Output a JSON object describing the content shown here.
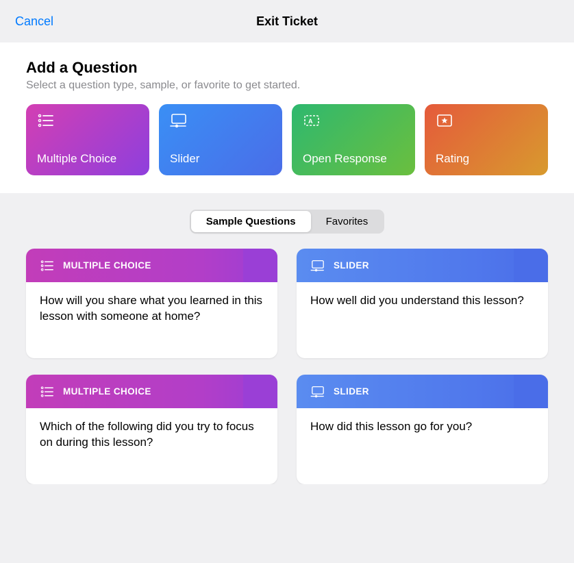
{
  "header": {
    "cancel": "Cancel",
    "title": "Exit Ticket"
  },
  "add": {
    "heading": "Add a Question",
    "subtext": "Select a question type, sample, or favorite to get started."
  },
  "types": [
    {
      "id": "multiple-choice",
      "label": "Multiple Choice",
      "icon": "list-icon",
      "gradient": "grad-purple"
    },
    {
      "id": "slider",
      "label": "Slider",
      "icon": "slider-icon",
      "gradient": "grad-blue"
    },
    {
      "id": "open-response",
      "label": "Open Response",
      "icon": "textbox-icon",
      "gradient": "grad-green"
    },
    {
      "id": "rating",
      "label": "Rating",
      "icon": "star-icon",
      "gradient": "grad-orange"
    }
  ],
  "segmented": {
    "sample": "Sample Questions",
    "favorites": "Favorites",
    "active": "sample"
  },
  "samples": [
    {
      "type": "multiple-choice",
      "type_label": "MULTIPLE CHOICE",
      "head_class": "head-purple",
      "icon": "list-icon",
      "question": "How will you share what you learned in this lesson with someone at home?"
    },
    {
      "type": "slider",
      "type_label": "SLIDER",
      "head_class": "head-blue",
      "icon": "slider-icon",
      "question": "How well did you understand this lesson?"
    },
    {
      "type": "multiple-choice",
      "type_label": "MULTIPLE CHOICE",
      "head_class": "head-purple",
      "icon": "list-icon",
      "question": "Which of the following did you try to focus on during this lesson?"
    },
    {
      "type": "slider",
      "type_label": "SLIDER",
      "head_class": "head-blue",
      "icon": "slider-icon",
      "question": "How did this lesson go for you?"
    }
  ]
}
